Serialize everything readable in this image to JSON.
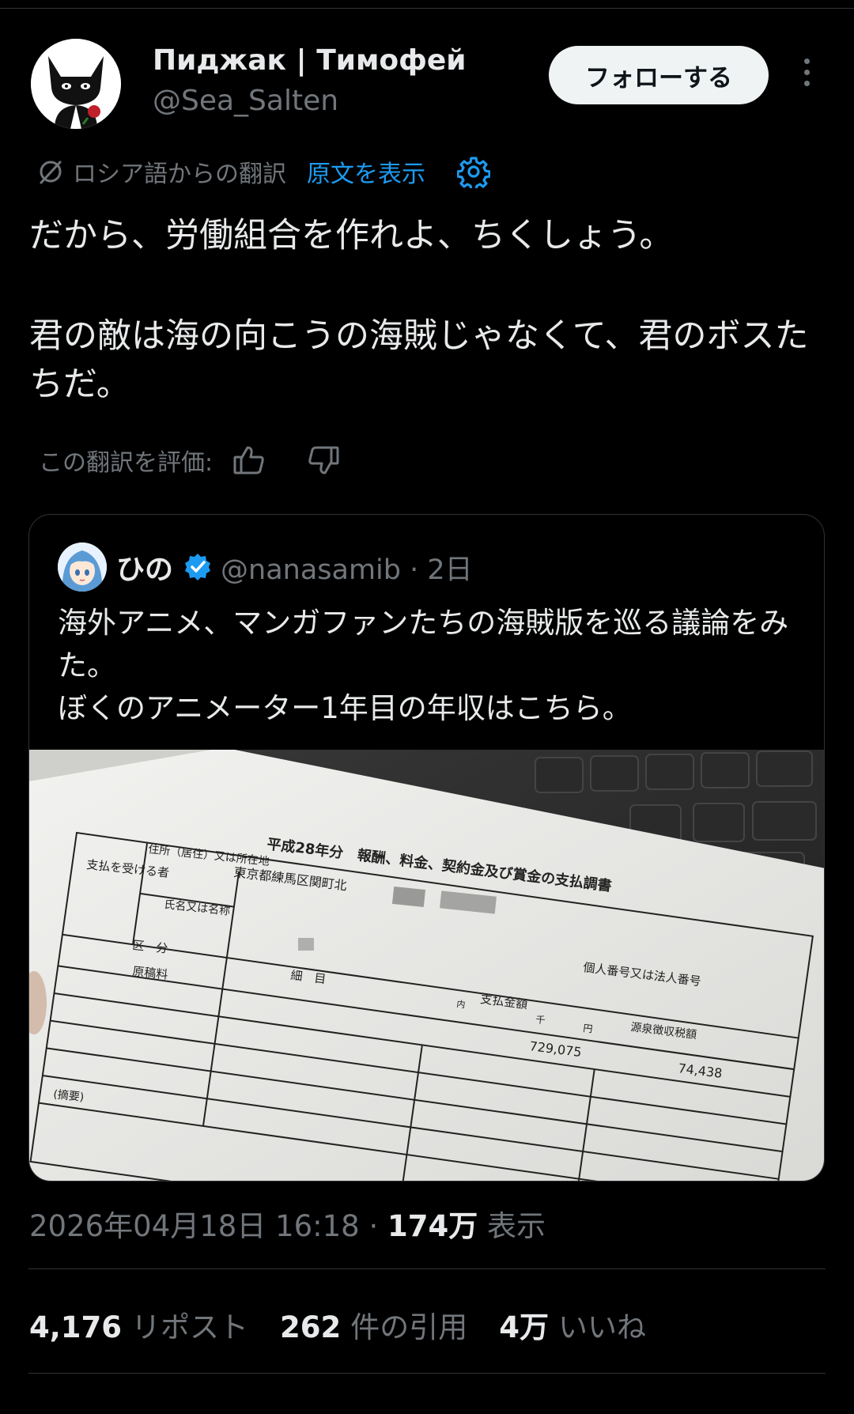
{
  "author": {
    "display_name": "Пиджак | Тимофей",
    "handle": "@Sea_Salten",
    "follow_label": "フォローする"
  },
  "translation": {
    "label": "ロシア語からの翻訳",
    "show_original": "原文を表示",
    "rate_label": "この翻訳を評価:"
  },
  "tweet": {
    "line1": "だから、労働組合を作れよ、ちくしょう。",
    "line2": "君の敵は海の向こうの海賊じゃなくて、君のボスたちだ。"
  },
  "quoted": {
    "name": "ひの",
    "handle_time": "@nanasamib · 2日",
    "line1": "海外アニメ、マンガファンたちの海賊版を巡る議論をみた。",
    "line2": "ぼくのアニメーター1年目の年収はこちら。",
    "document": {
      "title": "平成28年分　報酬、料金、契約金及び賞金の支払調書",
      "recipient_label": "支払を受ける者",
      "address_label": "住所（居住）又は所在地",
      "address_value": "東京都練馬区関町北",
      "name_label": "氏名又は名称",
      "category_label": "区　分",
      "item_label": "細　目",
      "pay_label": "支払金額",
      "tax_label": "源泉徴収税額",
      "id_label": "個人番号又は法人番号",
      "row_label": "原稿料",
      "memo_label": "(摘要)",
      "pay_amount": "729,075",
      "tax_amount": "74,438",
      "unit_inner": "内",
      "unit_thousand": "千",
      "unit_yen": "円"
    }
  },
  "meta": {
    "datetime": "2026年04月18日 16:18 · ",
    "views_value": "174万",
    "views_label": " 表示"
  },
  "stats": {
    "reposts_value": "4,176",
    "reposts_label": "リポスト",
    "quotes_value": "262",
    "quotes_label": "件の引用",
    "likes_value": "4万",
    "likes_label": "いいね"
  },
  "colors": {
    "background": "#000000",
    "text": "#e7e9ea",
    "muted": "#71767b",
    "link": "#1d9bf0",
    "divider": "#2f3336"
  }
}
